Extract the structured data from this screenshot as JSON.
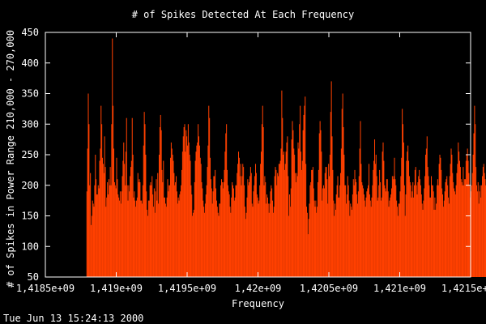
{
  "chart_data": {
    "type": "bar",
    "title": "# of Spikes Detected At Each Frequency",
    "xlabel": "Frequency",
    "ylabel": "# of Spikes in Power Range 210,000 - 270,000",
    "xlim": [
      1418500000,
      1421500000
    ],
    "ylim": [
      50,
      450
    ],
    "xticks": [
      1418500000,
      1419000000,
      1419500000,
      1420000000,
      1420500000,
      1421000000,
      1421500000
    ],
    "xtick_labels": [
      "1,4185e+09",
      "1,419e+09",
      "1,4195e+09",
      "1,42e+09",
      "1,4205e+09",
      "1,421e+09",
      "1,4215e+09"
    ],
    "yticks": [
      50,
      100,
      150,
      200,
      250,
      300,
      350,
      400,
      450
    ],
    "ytick_labels": [
      "50",
      "100",
      "150",
      "200",
      "250",
      "300",
      "350",
      "400",
      "450"
    ],
    "grid": false,
    "legend": "none",
    "bar_color": "#ff4000",
    "x_start": 1418790000,
    "x_step": 5000,
    "values": [
      190,
      260,
      350,
      300,
      200,
      220,
      135,
      150,
      175,
      170,
      165,
      200,
      250,
      210,
      185,
      185,
      200,
      195,
      240,
      260,
      330,
      300,
      245,
      235,
      220,
      280,
      230,
      165,
      180,
      205,
      185,
      210,
      200,
      230,
      200,
      300,
      440,
      330,
      260,
      205,
      200,
      195,
      245,
      210,
      185,
      180,
      175,
      190,
      170,
      190,
      215,
      240,
      270,
      235,
      200,
      255,
      310,
      200,
      175,
      200,
      190,
      215,
      230,
      240,
      310,
      250,
      180,
      190,
      175,
      165,
      175,
      180,
      220,
      205,
      210,
      205,
      175,
      175,
      170,
      200,
      265,
      320,
      300,
      250,
      190,
      160,
      150,
      175,
      175,
      200,
      205,
      200,
      215,
      185,
      165,
      195,
      155,
      190,
      210,
      175,
      220,
      170,
      250,
      295,
      315,
      290,
      225,
      205,
      240,
      180,
      180,
      170,
      165,
      180,
      210,
      190,
      200,
      200,
      245,
      270,
      260,
      250,
      240,
      220,
      200,
      205,
      215,
      190,
      170,
      180,
      175,
      185,
      190,
      200,
      225,
      255,
      280,
      295,
      300,
      255,
      290,
      280,
      265,
      300,
      270,
      250,
      240,
      200,
      185,
      150,
      155,
      160,
      205,
      240,
      255,
      265,
      270,
      300,
      280,
      265,
      245,
      235,
      205,
      195,
      175,
      165,
      155,
      170,
      185,
      200,
      230,
      265,
      330,
      310,
      245,
      210,
      195,
      170,
      190,
      215,
      215,
      225,
      195,
      175,
      165,
      155,
      150,
      170,
      170,
      200,
      210,
      205,
      195,
      205,
      225,
      255,
      285,
      300,
      225,
      200,
      190,
      185,
      165,
      155,
      180,
      205,
      200,
      195,
      175,
      180,
      200,
      200,
      220,
      235,
      255,
      245,
      215,
      235,
      200,
      215,
      235,
      230,
      200,
      165,
      145,
      155,
      180,
      210,
      200,
      205,
      215,
      230,
      220,
      170,
      165,
      190,
      200,
      215,
      235,
      220,
      185,
      180,
      170,
      175,
      200,
      235,
      255,
      300,
      330,
      295,
      200,
      215,
      205,
      170,
      185,
      180,
      170,
      155,
      170,
      190,
      200,
      195,
      175,
      155,
      165,
      215,
      230,
      225,
      200,
      220,
      215,
      235,
      235,
      240,
      260,
      355,
      310,
      250,
      255,
      225,
      235,
      255,
      270,
      280,
      215,
      150,
      185,
      165,
      195,
      275,
      305,
      290,
      260,
      250,
      220,
      205,
      220,
      215,
      270,
      260,
      300,
      330,
      255,
      225,
      240,
      290,
      315,
      330,
      345,
      235,
      165,
      155,
      120,
      145,
      170,
      200,
      205,
      225,
      225,
      230,
      195,
      175,
      165,
      175,
      155,
      165,
      205,
      225,
      285,
      305,
      290,
      255,
      175,
      195,
      200,
      195,
      220,
      230,
      230,
      210,
      170,
      235,
      215,
      250,
      320,
      370,
      280,
      225,
      175,
      150,
      170,
      160,
      185,
      200,
      215,
      180,
      180,
      200,
      220,
      260,
      325,
      350,
      295,
      250,
      200,
      200,
      170,
      185,
      215,
      200,
      175,
      150,
      170,
      165,
      160,
      185,
      210,
      200,
      225,
      210,
      205,
      185,
      170,
      190,
      215,
      260,
      305,
      235,
      205,
      200,
      195,
      185,
      175,
      165,
      180,
      190,
      195,
      200,
      235,
      185,
      175,
      165,
      180,
      200,
      225,
      240,
      275,
      235,
      250,
      215,
      175,
      180,
      200,
      225,
      205,
      175,
      180,
      255,
      270,
      240,
      200,
      195,
      190,
      210,
      210,
      190,
      165,
      175,
      180,
      185,
      195,
      215,
      210,
      215,
      245,
      210,
      200,
      175,
      165,
      150,
      170,
      170,
      190,
      215,
      245,
      325,
      300,
      270,
      200,
      150,
      185,
      240,
      255,
      265,
      240,
      215,
      205,
      200,
      180,
      190,
      205,
      180,
      200,
      225,
      230,
      200,
      185,
      205,
      215,
      225,
      210,
      200,
      185,
      170,
      160,
      175,
      195,
      215,
      250,
      260,
      280,
      230,
      215,
      200,
      180,
      180,
      215,
      200,
      200,
      190,
      160,
      180,
      160,
      170,
      200,
      210,
      200,
      235,
      250,
      245,
      225,
      195,
      185,
      165,
      175,
      190,
      205,
      210,
      215,
      200,
      180,
      170,
      215,
      235,
      260,
      250,
      220,
      205,
      195,
      190,
      185,
      200,
      220,
      235,
      270,
      255,
      240,
      230,
      210,
      205,
      200,
      230,
      200,
      210,
      210,
      240,
      250,
      260,
      240,
      220,
      200,
      180,
      190,
      200,
      220,
      250,
      285,
      330,
      300,
      230,
      200,
      190,
      205,
      170,
      190,
      200,
      180,
      200,
      215,
      230,
      235,
      220,
      210,
      200,
      200,
      215,
      225,
      255,
      280,
      320,
      345,
      290,
      250,
      215,
      220,
      215,
      200,
      200,
      210,
      205,
      210,
      225,
      200,
      175,
      170,
      190,
      205,
      215,
      230,
      260,
      265,
      240,
      220,
      200,
      220,
      230,
      255,
      290,
      230,
      205,
      200,
      185,
      175,
      190,
      195,
      210,
      200,
      215,
      225,
      260,
      245,
      235,
      225,
      210,
      200,
      190,
      195,
      210,
      230,
      260,
      255,
      225,
      200,
      190,
      175,
      200,
      215,
      220,
      215,
      195,
      180,
      170,
      165,
      175,
      205,
      235,
      240,
      210,
      190,
      180,
      200,
      225,
      255,
      275,
      260,
      240,
      270,
      250,
      240,
      225,
      210,
      195,
      180,
      205,
      220,
      255,
      270,
      250,
      210,
      200,
      185,
      220,
      265,
      290,
      270,
      225,
      200,
      195,
      210,
      220,
      230,
      240,
      250,
      300,
      335,
      290,
      260,
      260,
      300,
      250,
      205,
      210
    ]
  }
}
